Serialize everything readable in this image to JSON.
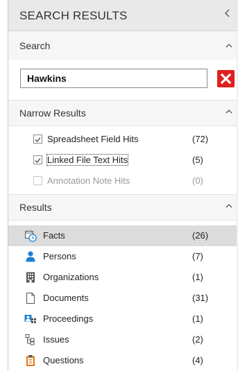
{
  "panel": {
    "title": "SEARCH RESULTS"
  },
  "search_section": {
    "label": "Search",
    "query": "Hawkins"
  },
  "narrow_section": {
    "label": "Narrow Results",
    "items": [
      {
        "label": "Spreadsheet Field Hits",
        "count": "(72)",
        "checked": true,
        "enabled": true
      },
      {
        "label": "Linked File Text Hits",
        "count": "(5)",
        "checked": true,
        "enabled": true
      },
      {
        "label": "Annotation Note Hits",
        "count": "(0)",
        "checked": false,
        "enabled": false
      }
    ]
  },
  "results_section": {
    "label": "Results",
    "items": [
      {
        "label": "Facts",
        "count": "(26)",
        "icon": "calendar-clock-icon",
        "selected": true
      },
      {
        "label": "Persons",
        "count": "(7)",
        "icon": "person-icon",
        "selected": false
      },
      {
        "label": "Organizations",
        "count": "(1)",
        "icon": "building-icon",
        "selected": false
      },
      {
        "label": "Documents",
        "count": "(31)",
        "icon": "document-icon",
        "selected": false
      },
      {
        "label": "Proceedings",
        "count": "(1)",
        "icon": "proceedings-icon",
        "selected": false
      },
      {
        "label": "Issues",
        "count": "(2)",
        "icon": "issues-tree-icon",
        "selected": false
      },
      {
        "label": "Questions",
        "count": "(4)",
        "icon": "clipboard-icon",
        "selected": false
      }
    ]
  },
  "colors": {
    "accent_red": "#e01f1f",
    "person_blue": "#1e7fd0",
    "selection": "#dcdcdc",
    "clipboard_orange": "#e07b1a"
  }
}
